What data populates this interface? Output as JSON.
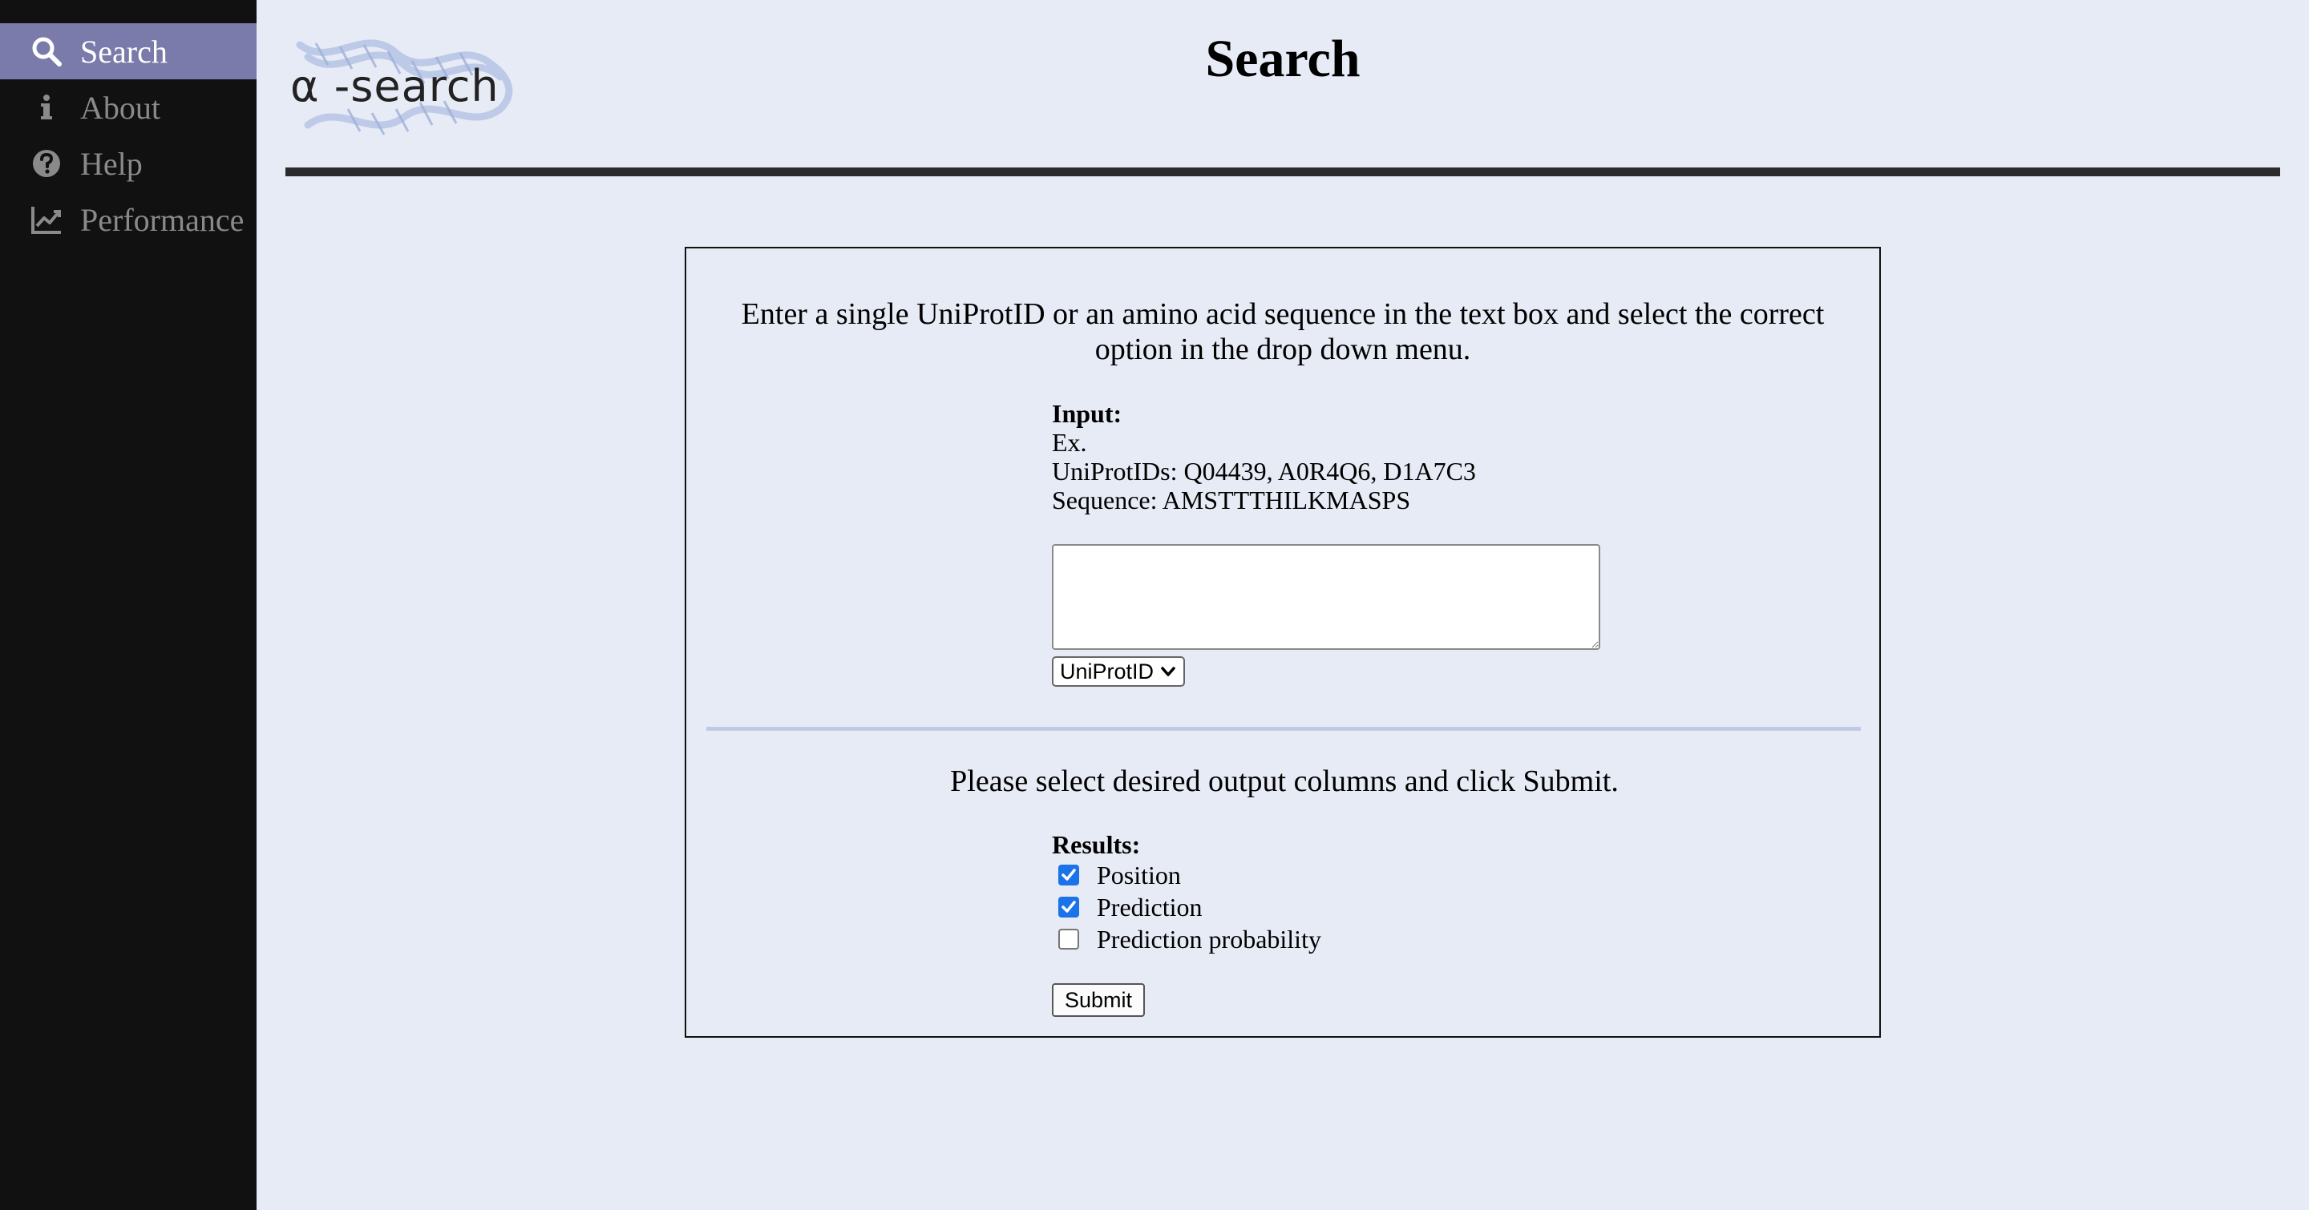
{
  "sidebar": {
    "items": [
      {
        "label": "Search",
        "icon": "search-icon",
        "active": true
      },
      {
        "label": "About",
        "icon": "info-icon",
        "active": false
      },
      {
        "label": "Help",
        "icon": "help-icon",
        "active": false
      },
      {
        "label": "Performance",
        "icon": "line-chart-icon",
        "active": false
      }
    ]
  },
  "header": {
    "logo_text": "α -search",
    "title": "Search"
  },
  "form": {
    "instructions": "Enter a single UniProtID or an amino acid sequence in the text box and select the correct option in the drop down menu.",
    "input_heading": "Input:",
    "example_label": "Ex.",
    "example_ids": "UniProtIDs: Q04439, A0R4Q6, D1A7C3",
    "example_sequence": "Sequence: AMSTTTHILKMASPS",
    "textarea_value": "",
    "select_value": "UniProtID",
    "output_instructions": "Please select desired output columns and click Submit.",
    "results_heading": "Results:",
    "checkboxes": [
      {
        "label": "Position",
        "checked": true
      },
      {
        "label": "Prediction",
        "checked": true
      },
      {
        "label": "Prediction probability",
        "checked": false
      }
    ],
    "submit_label": "Submit"
  },
  "colors": {
    "background": "#e7ebf5",
    "sidebar": "#111111",
    "sidebar_active": "#7b7bab",
    "checkbox_checked": "#1a73e8"
  }
}
